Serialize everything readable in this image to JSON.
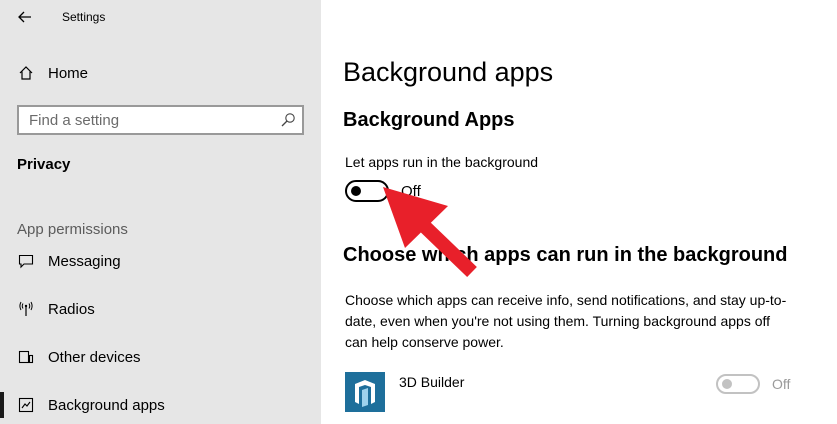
{
  "window": {
    "title": "Settings"
  },
  "sidebar": {
    "home_label": "Home",
    "search_placeholder": "Find a setting",
    "category": "Privacy",
    "section_header": "App permissions",
    "items": [
      {
        "label": "Messaging",
        "icon": "message-icon"
      },
      {
        "label": "Radios",
        "icon": "radio-tower-icon"
      },
      {
        "label": "Other devices",
        "icon": "devices-icon"
      },
      {
        "label": "Background apps",
        "icon": "background-apps-icon",
        "selected": true
      }
    ]
  },
  "main": {
    "page_title": "Background apps",
    "section_title": "Background Apps",
    "toggle_caption": "Let apps run in the background",
    "toggle_state": "Off",
    "section2_title": "Choose which apps can run in the background",
    "description": "Choose which apps can receive info, send notifications, and stay up-to-date, even when you're not using them. Turning background apps off can help conserve power.",
    "apps": [
      {
        "name": "3D Builder",
        "state": "Off",
        "icon": "3d-builder-icon"
      }
    ]
  },
  "colors": {
    "sidebar_bg": "#e6e6e6",
    "arrow": "#e8202a",
    "app_icon_bg": "#1e6f9b"
  }
}
